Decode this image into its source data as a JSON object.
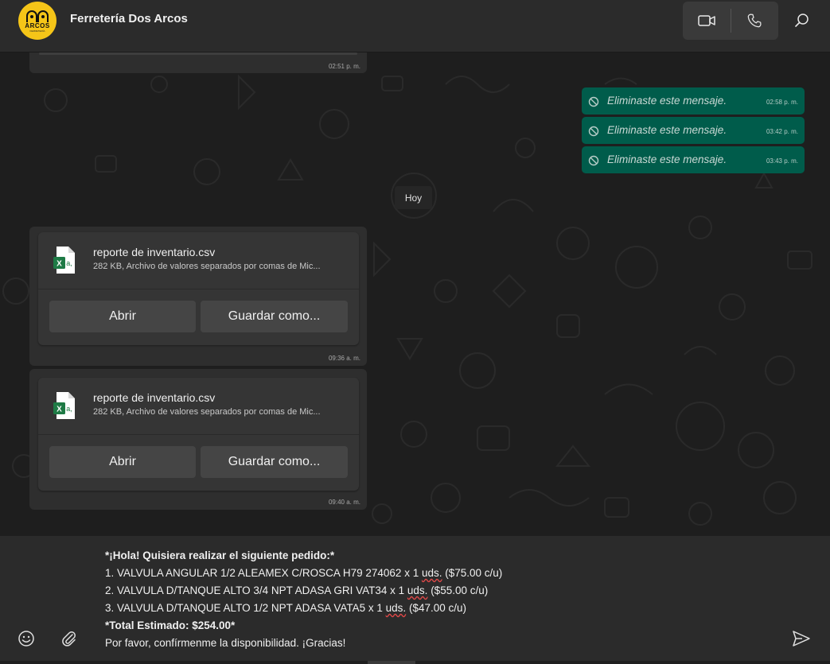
{
  "header": {
    "contact_name": "Ferretería Dos Arcos",
    "avatar_text": "ARCOS",
    "avatar_subtext": "FERRETERÍA",
    "avatar_color": "#f5c518"
  },
  "chat": {
    "top_message_time": "02:51 p. m.",
    "deleted_messages": [
      {
        "text": "Eliminaste este mensaje.",
        "time": "02:58 p. m."
      },
      {
        "text": "Eliminaste este mensaje.",
        "time": "03:42 p. m."
      },
      {
        "text": "Eliminaste este mensaje.",
        "time": "03:43 p. m."
      }
    ],
    "day_separator": "Hoy",
    "files": [
      {
        "name": "reporte de inventario.csv",
        "meta": "282 KB, Archivo de valores separados por comas de Mic...",
        "open_label": "Abrir",
        "save_label": "Guardar como...",
        "time": "09:36 a. m."
      },
      {
        "name": "reporte de inventario.csv",
        "meta": "282 KB, Archivo de valores separados por comas de Mic...",
        "open_label": "Abrir",
        "save_label": "Guardar como...",
        "time": "09:40 a. m."
      }
    ],
    "outgoing_color": "#005c4b"
  },
  "composer": {
    "line1": "*¡Hola! Quisiera realizar el siguiente pedido:*",
    "line2_a": "1. VALVULA ANGULAR 1/2 ALEAMEX C/ROSCA H79 274062 x 1 ",
    "line2_b": "uds.",
    "line2_c": " ($75.00 c/u)",
    "line3_a": "2. VALVULA D/TANQUE ALTO 3/4 NPT ADASA GRI VAT34 x 1 ",
    "line3_b": "uds.",
    "line3_c": " ($55.00 c/u)",
    "line4_a": "3. VALVULA D/TANQUE ALTO 1/2 NPT ADASA VATA5 x 1 ",
    "line4_b": "uds.",
    "line4_c": " ($47.00 c/u)",
    "line5": "*Total Estimado: $254.00*",
    "line6": "Por favor, confírmenme la disponibilidad. ¡Gracias!",
    "icons": [
      "emoji-icon",
      "attach-icon",
      "send-icon"
    ]
  }
}
